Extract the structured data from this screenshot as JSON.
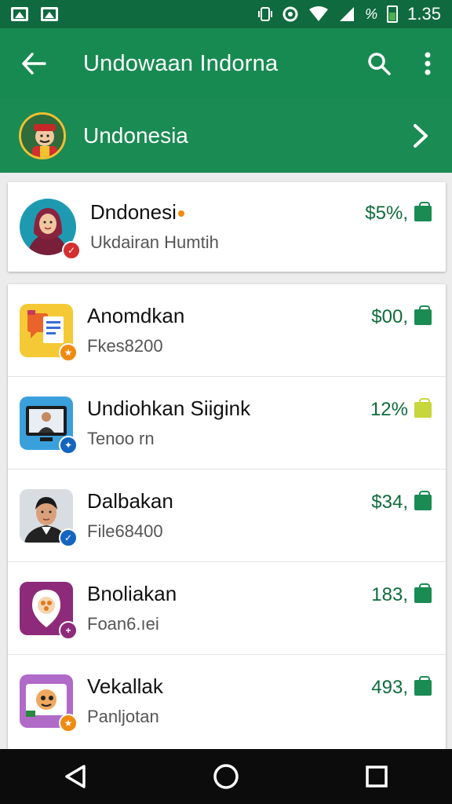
{
  "status_bar": {
    "time": "1.35",
    "battery_text": "%",
    "icons": [
      "image-icon",
      "gallery-icon",
      "vibrate-icon",
      "alarm-icon",
      "wifi-icon",
      "signal-icon",
      "battery-icon"
    ]
  },
  "app_bar": {
    "title": "Undowaan Indorna",
    "back_icon": "arrow-left-icon",
    "search_icon": "search-icon",
    "menu_icon": "more-vert-icon"
  },
  "banner": {
    "label": "Undonesia",
    "avatar": "character-avatar",
    "chevron_icon": "chevron-right-icon"
  },
  "featured": {
    "title": "Dndonesi",
    "subtitle": "Ukdairan Humtih",
    "price": "$5%,",
    "badge_color": "#d32f2f"
  },
  "items": [
    {
      "title": "Anomdkan",
      "subtitle": "Fkes8200",
      "price": "$00,",
      "bag": "green",
      "badge_color": "#f08a10"
    },
    {
      "title": "Undiohkan Siigink",
      "subtitle": "Tenoo rn",
      "price": "12%",
      "bag": "yellow",
      "badge_color": "#1565c0"
    },
    {
      "title": "Dalbakan",
      "subtitle": "File68400",
      "price": "$34,",
      "bag": "green",
      "badge_color": "#1565c0"
    },
    {
      "title": "Bnoliakan",
      "subtitle": "Foan6.ıei",
      "price": "183,",
      "bag": "green",
      "badge_color": "#8e2a7a"
    },
    {
      "title": "Vekallak",
      "subtitle": "Panljotan",
      "price": "493,",
      "bag": "green",
      "badge_color": "#f08a10"
    }
  ],
  "colors": {
    "status_bar": "#106a3f",
    "app_bar": "#178a51",
    "accent": "#0f6b3c"
  }
}
